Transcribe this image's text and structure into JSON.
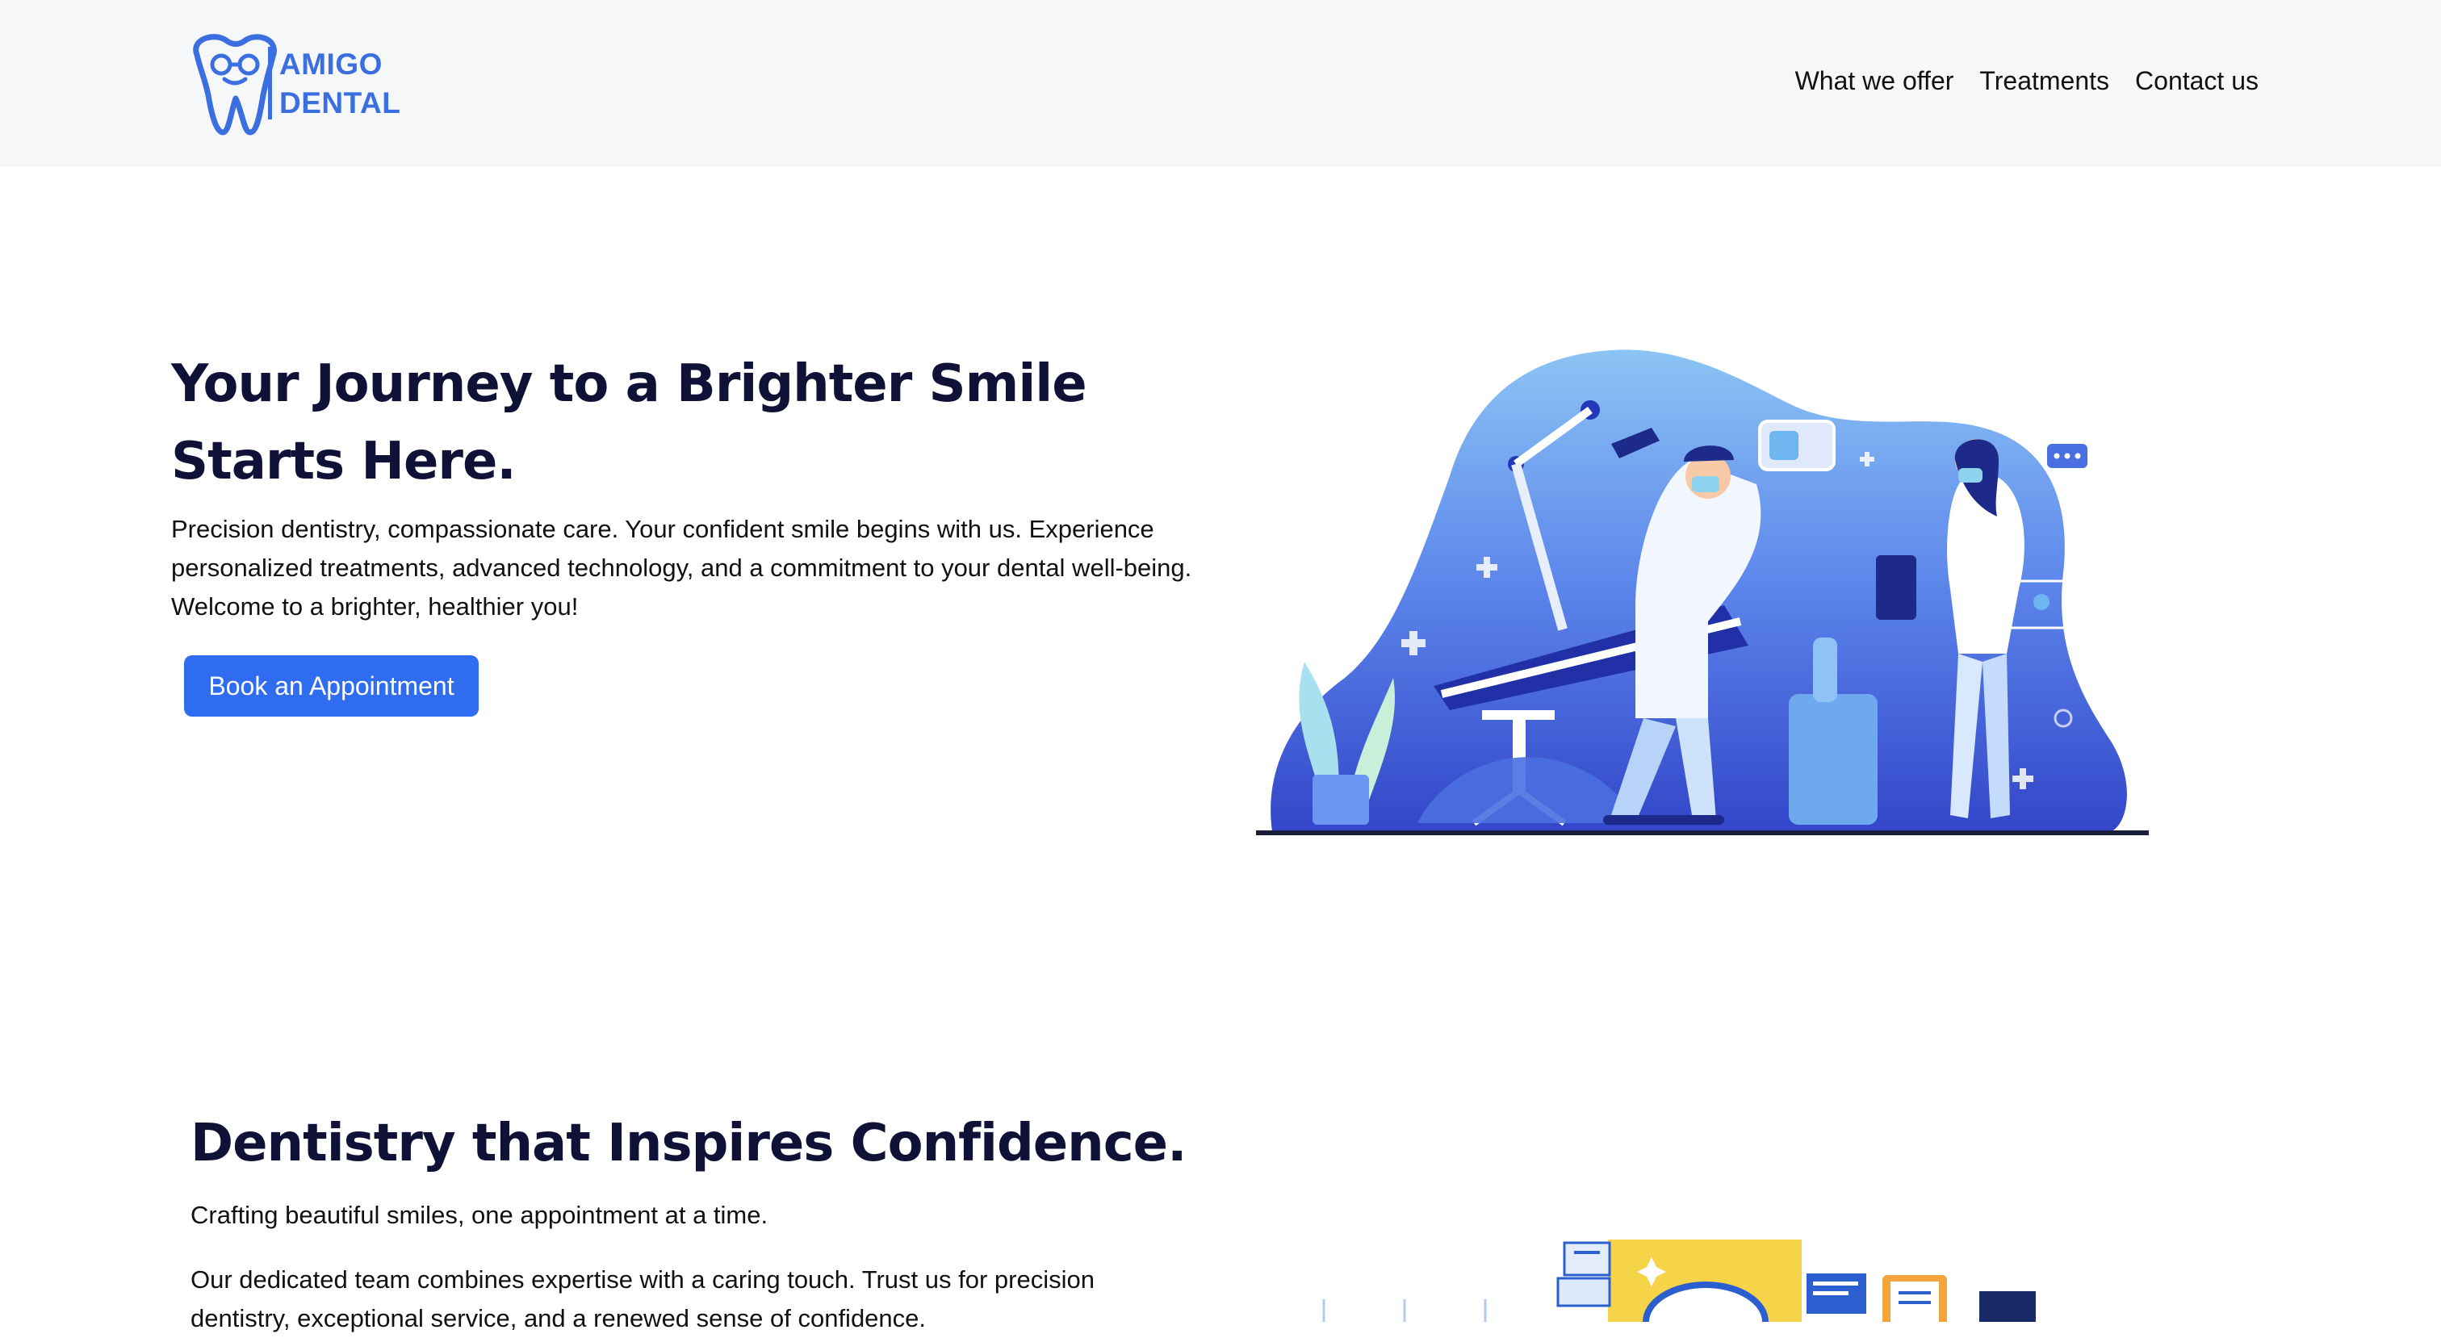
{
  "brand": {
    "line1": "AMIGO",
    "line2": "DENTAL",
    "color": "#3b6ee0"
  },
  "nav": {
    "items": [
      {
        "label": "What we offer"
      },
      {
        "label": "Treatments"
      },
      {
        "label": "Contact us"
      }
    ]
  },
  "hero": {
    "title": "Your Journey to a Brighter Smile Starts Here.",
    "text": "Precision dentistry, compassionate care. Your confident smile begins with us. Experience personalized treatments, advanced technology, and a commitment to your dental well-being. Welcome to a brighter, healthier you!",
    "cta_label": "Book an Appointment",
    "cta_color": "#2f6cf0",
    "illustration_icon": "dental-clinic-illustration"
  },
  "section2": {
    "title": "Dentistry that Inspires Confidence.",
    "subtitle": "Crafting beautiful smiles, one appointment at a time.",
    "body": "Our dedicated team combines expertise with a caring touch. Trust us for precision dentistry, exceptional service, and a renewed sense of confidence.",
    "illustration_icon": "dental-records-illustration"
  }
}
